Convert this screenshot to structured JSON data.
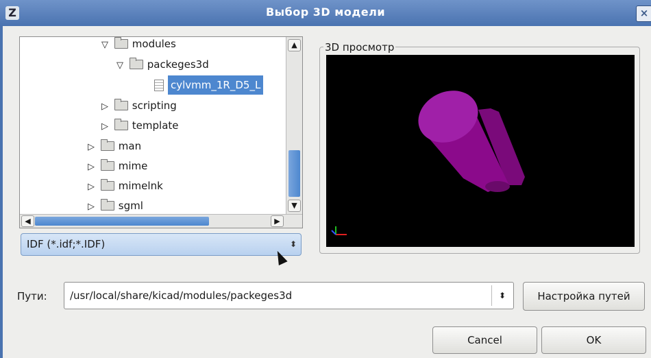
{
  "window": {
    "title": "Выбор 3D модели",
    "app_icon": "kicad-icon",
    "close_glyph": "×"
  },
  "tree": {
    "rows": [
      {
        "label": "modules",
        "expanded": true
      },
      {
        "label": "packeges3d",
        "expanded": true
      },
      {
        "label": "cylvmm_1R_D5_L",
        "selected": true,
        "type": "file"
      },
      {
        "label": "scripting",
        "expanded": false
      },
      {
        "label": "template",
        "expanded": false
      },
      {
        "label": "man",
        "expanded": false
      },
      {
        "label": "mime",
        "expanded": false
      },
      {
        "label": "mimelnk",
        "expanded": false
      },
      {
        "label": "sgml",
        "expanded": false
      }
    ]
  },
  "filter": {
    "value": "IDF (*.idf;*.IDF)"
  },
  "preview": {
    "legend": "3D просмотр",
    "model_color": "#8b0a8b",
    "background": "#000000"
  },
  "paths": {
    "label": "Пути:",
    "value": "/usr/local/share/kicad/modules/packeges3d",
    "configure_button": "Настройка путей"
  },
  "buttons": {
    "cancel": "Cancel",
    "ok": "OK"
  },
  "glyphs": {
    "expanded": "▽",
    "collapsed": "▷",
    "up": "▲",
    "down": "▼",
    "left": "◀",
    "right": "▶",
    "spin": "⬍"
  }
}
